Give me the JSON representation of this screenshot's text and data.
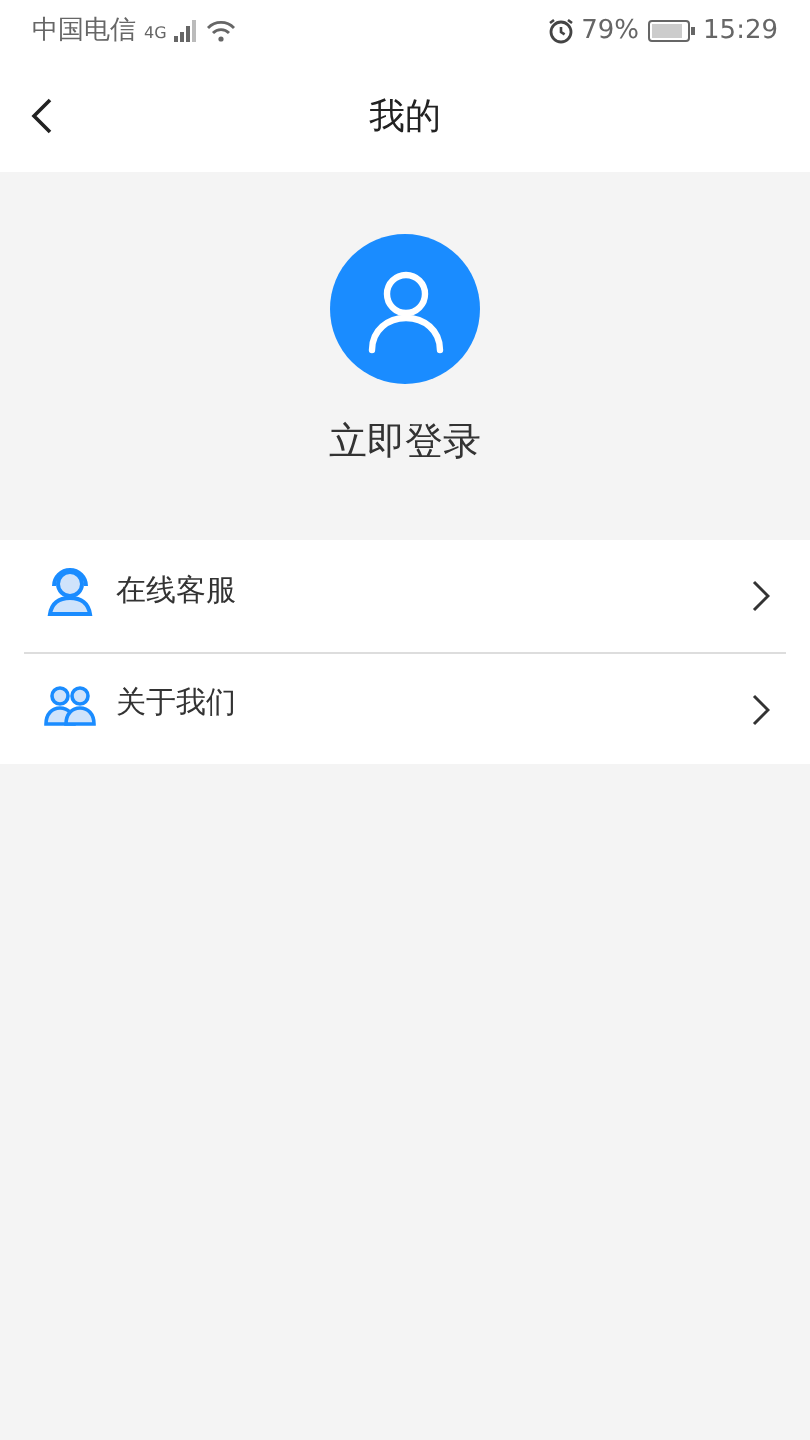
{
  "status_bar": {
    "carrier": "中国电信",
    "network": "4G",
    "battery": "79%",
    "time": "15:29"
  },
  "header": {
    "title": "我的"
  },
  "profile": {
    "login": "立即登录"
  },
  "menu": [
    {
      "kind": "service",
      "label": "在线客服"
    },
    {
      "kind": "team",
      "label": "关于我们"
    }
  ]
}
